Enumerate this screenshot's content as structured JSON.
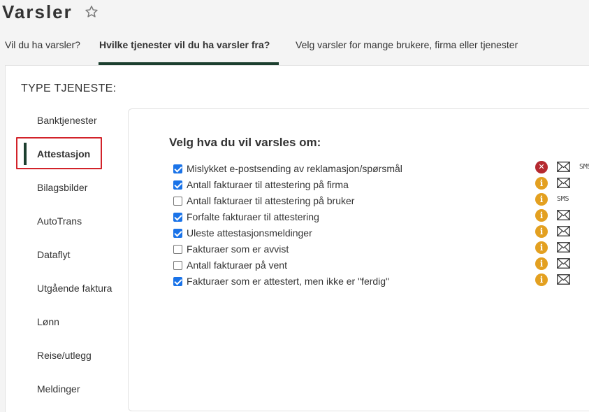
{
  "page": {
    "title": "Varsler"
  },
  "icons": {
    "favorite": "star-outline-icon"
  },
  "tabs": [
    {
      "label": "Vil du ha varsler?"
    },
    {
      "label": "Hvilke tjenester vil du ha varsler fra?"
    },
    {
      "label": "Velg varsler for mange brukere, firma eller tjenester"
    }
  ],
  "active_tab": 1,
  "type_heading": "TYPE TJENESTE:",
  "sidebar": {
    "items": [
      {
        "label": "Banktjenester"
      },
      {
        "label": "Attestasjon"
      },
      {
        "label": "Bilagsbilder"
      },
      {
        "label": "AutoTrans"
      },
      {
        "label": "Dataflyt"
      },
      {
        "label": "Utgående faktura"
      },
      {
        "label": "Lønn"
      },
      {
        "label": "Reise/utlegg"
      },
      {
        "label": "Meldinger"
      }
    ],
    "active_index": 1
  },
  "content": {
    "heading": "Velg hva du vil varsles om:",
    "sms_label": "SMS",
    "options": [
      {
        "label": "Mislykket e-postsending av reklamasjon/spørsmål",
        "checked": true,
        "status": "error",
        "channels": [
          "email",
          "sms"
        ]
      },
      {
        "label": "Antall fakturaer til attestering på firma",
        "checked": true,
        "status": "info",
        "channels": [
          "email"
        ]
      },
      {
        "label": "Antall fakturaer til attestering på bruker",
        "checked": false,
        "status": "info",
        "channels": [
          "sms"
        ]
      },
      {
        "label": "Forfalte fakturaer til attestering",
        "checked": true,
        "status": "info",
        "channels": [
          "email"
        ]
      },
      {
        "label": "Uleste attestasjonsmeldinger",
        "checked": true,
        "status": "info",
        "channels": [
          "email"
        ]
      },
      {
        "label": "Fakturaer som er avvist",
        "checked": false,
        "status": "info",
        "channels": [
          "email"
        ]
      },
      {
        "label": "Antall fakturaer på vent",
        "checked": false,
        "status": "info",
        "channels": [
          "email"
        ]
      },
      {
        "label": "Fakturaer som er attestert, men ikke er \"ferdig\"",
        "checked": true,
        "status": "info",
        "channels": [
          "email"
        ]
      }
    ]
  },
  "colors": {
    "accent_green": "#1c3f2f",
    "highlight_red": "#d2232a",
    "checkbox_blue": "#1a73e8",
    "error_red": "#b5292f",
    "info_orange": "#e3a020"
  }
}
